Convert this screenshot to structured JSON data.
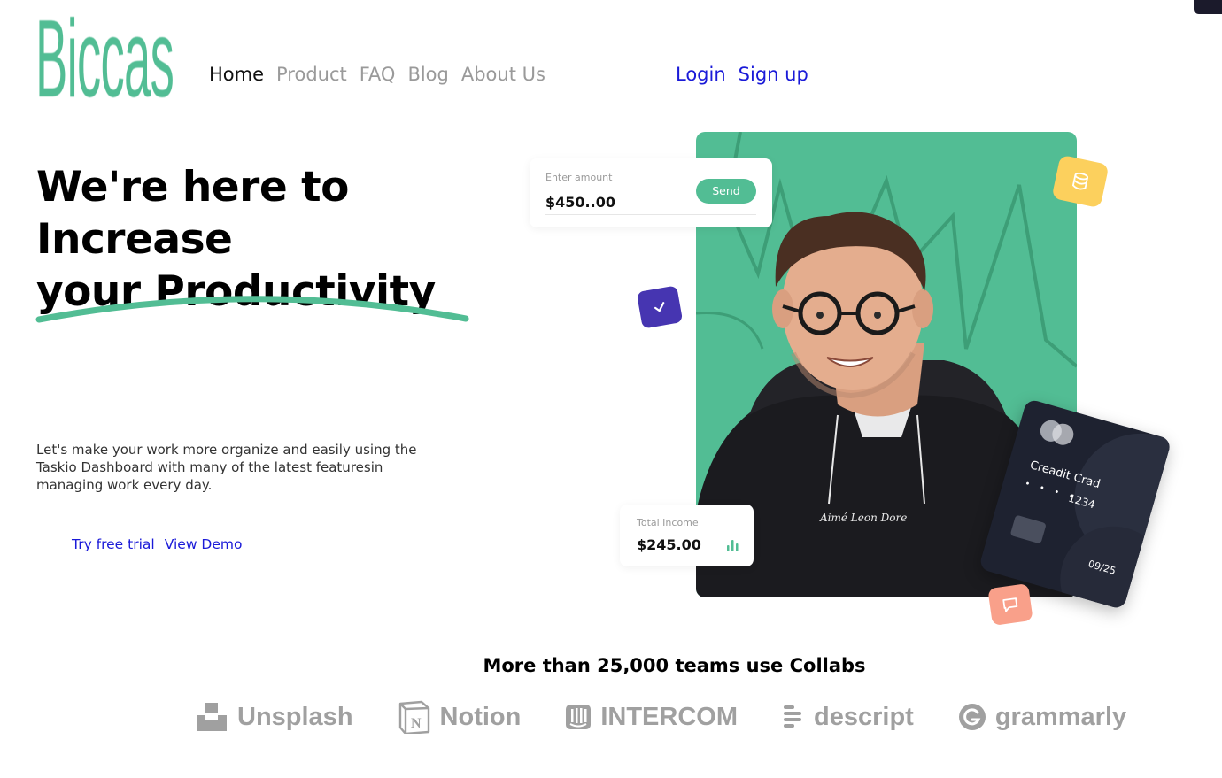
{
  "logo": {
    "text": "Biccas"
  },
  "nav": {
    "items": [
      {
        "label": "Home",
        "active": true
      },
      {
        "label": "Product",
        "active": false
      },
      {
        "label": "FAQ",
        "active": false
      },
      {
        "label": "Blog",
        "active": false
      },
      {
        "label": "About Us",
        "active": false
      }
    ],
    "login": "Login",
    "signup": "Sign up"
  },
  "hero": {
    "headline_line1": "We're here to Increase",
    "headline_line2": "your Productivity",
    "description": "Let's make your work more organize and easily using the Taskio Dashboard with many of the latest featuresin managing work every day.",
    "try_free": "Try free trial",
    "view_demo": "View Demo"
  },
  "amount_card": {
    "label": "Enter amount",
    "value": "$450..00",
    "send": "Send"
  },
  "income_card": {
    "label": "Total Income",
    "value": "$245.00"
  },
  "credit_card": {
    "name": "Creadit Crad",
    "dots": "• • • •",
    "number": "1234",
    "expiry": "09/25"
  },
  "photo": {
    "hoodie_text": "Aimé Leon Dore"
  },
  "teams": {
    "heading": "More than 25,000 teams use Collabs",
    "brands": [
      "Unsplash",
      "Notion",
      "INTERCOM",
      "descript",
      "grammarly"
    ]
  },
  "colors": {
    "accent_green": "#52bd94",
    "link_blue": "#1a1ad8",
    "purple": "#4635b1",
    "yellow": "#fcd05d",
    "salmon": "#f9a08a",
    "card_dark": "#1e2230"
  },
  "icons": [
    "check-icon",
    "database-icon",
    "chat-icon",
    "bar-chart-icon",
    "unsplash-icon",
    "notion-icon",
    "intercom-icon",
    "descript-icon",
    "grammarly-icon"
  ]
}
